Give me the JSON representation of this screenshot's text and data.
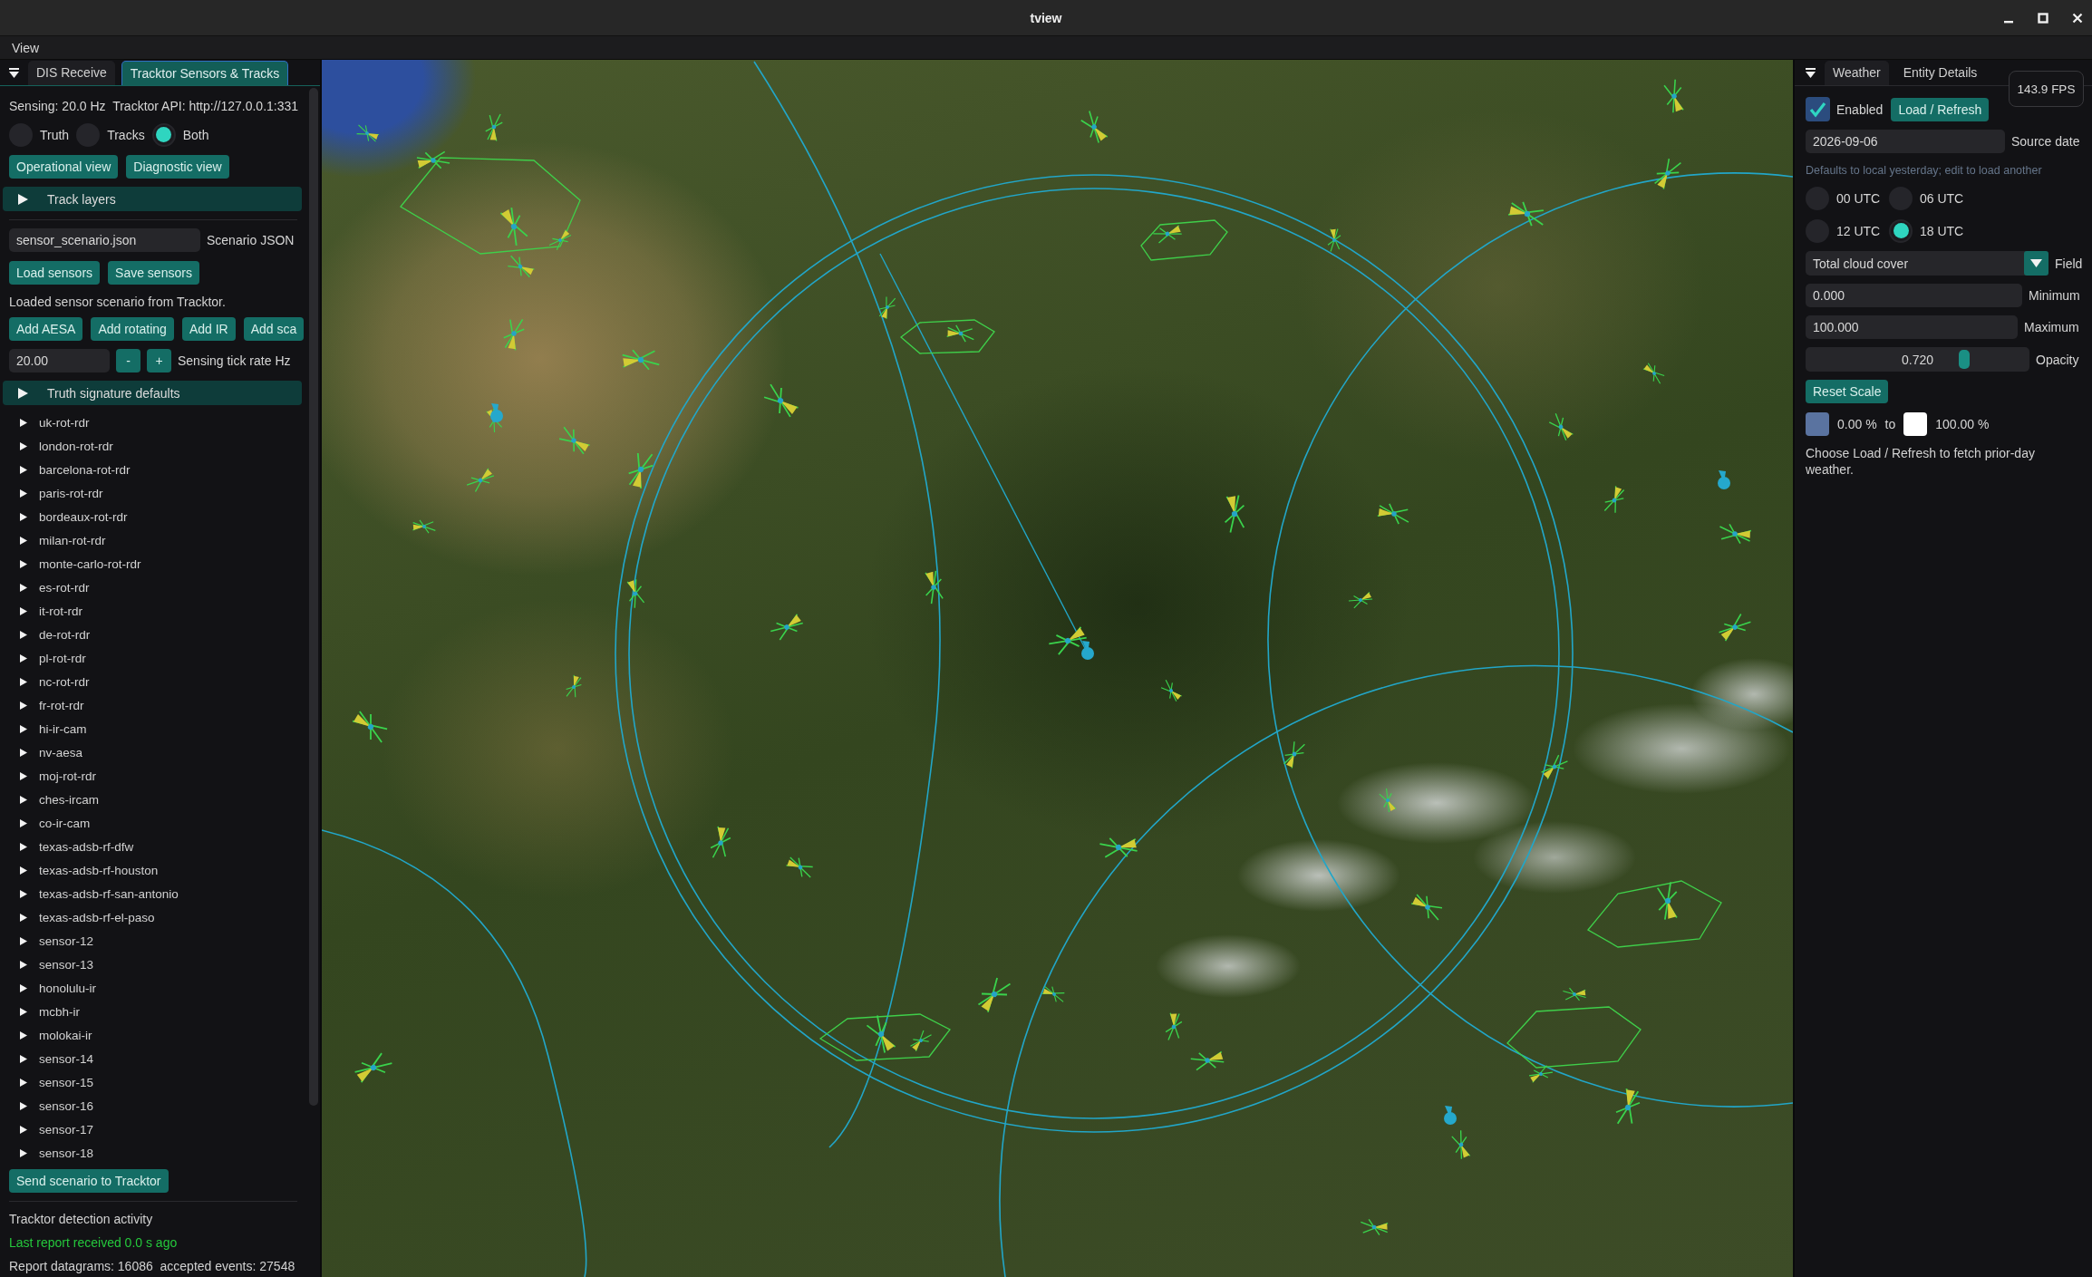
{
  "window": {
    "title": "tview"
  },
  "menu_bar": {
    "items": [
      "View"
    ]
  },
  "left_panel": {
    "focused": true,
    "tabs": [
      {
        "label": "DIS Receive",
        "selected": false
      },
      {
        "label": "Tracktor Sensors & Tracks",
        "selected": true
      }
    ],
    "status_line": "Sensing: 20.0 Hz  Tracktor API: http://127.0.0.1:331",
    "view_mode": [
      {
        "label": "Truth",
        "selected": false
      },
      {
        "label": "Tracks",
        "selected": false
      },
      {
        "label": "Both",
        "selected": true
      }
    ],
    "view_buttons": [
      "Operational view",
      "Diagnostic view"
    ],
    "track_layers": {
      "label": "Track layers",
      "expanded": false
    },
    "scenario_file": {
      "value": "sensor_scenario.json",
      "label": "Scenario JSON"
    },
    "file_buttons": [
      "Load sensors",
      "Save sensors"
    ],
    "load_message": "Loaded sensor scenario from Tracktor.",
    "add_buttons": [
      "Add AESA",
      "Add rotating",
      "Add IR",
      "Add sca"
    ],
    "tick_rate": {
      "value": "20.00",
      "decrement": "-",
      "increment": "+",
      "label": "Sensing tick rate Hz"
    },
    "truth_defaults": {
      "label": "Truth signature defaults",
      "expanded": false
    },
    "sensors": [
      {
        "name": "uk-rot-rdr",
        "expanded": false
      },
      {
        "name": "london-rot-rdr",
        "expanded": false
      },
      {
        "name": "barcelona-rot-rdr",
        "expanded": false
      },
      {
        "name": "paris-rot-rdr",
        "expanded": false
      },
      {
        "name": "bordeaux-rot-rdr",
        "expanded": false
      },
      {
        "name": "milan-rot-rdr",
        "expanded": false
      },
      {
        "name": "monte-carlo-rot-rdr",
        "expanded": false
      },
      {
        "name": "es-rot-rdr",
        "expanded": false
      },
      {
        "name": "it-rot-rdr",
        "expanded": false
      },
      {
        "name": "de-rot-rdr",
        "expanded": false
      },
      {
        "name": "pl-rot-rdr",
        "expanded": false
      },
      {
        "name": "nc-rot-rdr",
        "expanded": false
      },
      {
        "name": "fr-rot-rdr",
        "expanded": false
      },
      {
        "name": "hi-ir-cam",
        "expanded": false
      },
      {
        "name": "nv-aesa",
        "expanded": false
      },
      {
        "name": "moj-rot-rdr",
        "expanded": false
      },
      {
        "name": "ches-ircam",
        "expanded": false
      },
      {
        "name": "co-ir-cam",
        "expanded": false
      },
      {
        "name": "texas-adsb-rf-dfw",
        "expanded": false
      },
      {
        "name": "texas-adsb-rf-houston",
        "expanded": false
      },
      {
        "name": "texas-adsb-rf-san-antonio",
        "expanded": false
      },
      {
        "name": "texas-adsb-rf-el-paso",
        "expanded": false
      },
      {
        "name": "sensor-12",
        "expanded": false
      },
      {
        "name": "sensor-13",
        "expanded": false
      },
      {
        "name": "honolulu-ir",
        "expanded": false
      },
      {
        "name": "mcbh-ir",
        "expanded": false
      },
      {
        "name": "molokai-ir",
        "expanded": false
      },
      {
        "name": "sensor-14",
        "expanded": false
      },
      {
        "name": "sensor-15",
        "expanded": false
      },
      {
        "name": "sensor-16",
        "expanded": false
      },
      {
        "name": "sensor-17",
        "expanded": false
      },
      {
        "name": "sensor-18",
        "expanded": false
      }
    ],
    "send_button": "Send scenario to Tracktor",
    "activity": {
      "title": "Tracktor detection activity",
      "last_report": "Last report received 0.0 s ago",
      "counts": "Report datagrams: 16086  accepted events: 27548"
    }
  },
  "right_panel": {
    "focused": false,
    "tabs": [
      {
        "label": "Weather",
        "selected": true
      },
      {
        "label": "Entity Details",
        "selected": false
      }
    ],
    "fps": "143.9 FPS",
    "enabled": {
      "label": "Enabled",
      "checked": true
    },
    "load_button": "Load / Refresh",
    "source_date": {
      "value": "2026-09-06",
      "label": "Source date"
    },
    "date_hint": "Defaults to local yesterday; edit to load another",
    "cycles": [
      {
        "label": "00 UTC",
        "selected": false
      },
      {
        "label": "06 UTC",
        "selected": false
      },
      {
        "label": "12 UTC",
        "selected": false
      },
      {
        "label": "18 UTC",
        "selected": true
      }
    ],
    "field": {
      "value": "Total cloud cover",
      "label": "Field"
    },
    "minimum": {
      "value": "0.000",
      "label": "Minimum"
    },
    "maximum": {
      "value": "100.000",
      "label": "Maximum"
    },
    "opacity": {
      "value": "0.720",
      "level": 0.72,
      "label": "Opacity"
    },
    "reset_button": "Reset Scale",
    "scale": {
      "low": {
        "label": "0.00 %",
        "color": "#5a73a0"
      },
      "joiner": "to",
      "high": {
        "label": "100.00 %",
        "color": "#ffffff"
      }
    },
    "help": "Choose Load / Refresh to fetch prior-day weather."
  }
}
